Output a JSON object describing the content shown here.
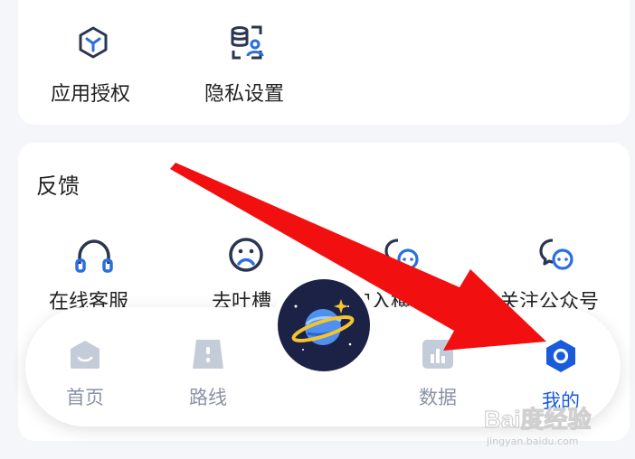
{
  "privacy_section": {
    "items": [
      {
        "label": "应用授权",
        "icon": "cube-icon"
      },
      {
        "label": "隐私设置",
        "icon": "database-user-icon"
      }
    ]
  },
  "feedback_section": {
    "title": "反馈",
    "items": [
      {
        "label": "在线客服",
        "icon": "headset-icon"
      },
      {
        "label": "去吐槽",
        "icon": "sad-face-icon"
      },
      {
        "label": "加入横...",
        "icon": "chat-bubble-icon"
      },
      {
        "label": "关注公众号",
        "icon": "chat-bubble-icon"
      }
    ]
  },
  "bottom_nav": {
    "items": [
      {
        "label": "首页",
        "icon": "home-icon"
      },
      {
        "label": "路线",
        "icon": "route-icon"
      },
      {
        "label": "数据",
        "icon": "bar-chart-icon"
      },
      {
        "label": "我的",
        "icon": "profile-hexagon-icon",
        "active": true
      }
    ],
    "center_icon": "planet-icon"
  },
  "watermark": {
    "brand": "Bai度经验",
    "url": "jingyan.baidu.com"
  },
  "colors": {
    "accent": "#1a5bdc",
    "inactive": "#8a93a6",
    "arrow": "#f20f10"
  }
}
